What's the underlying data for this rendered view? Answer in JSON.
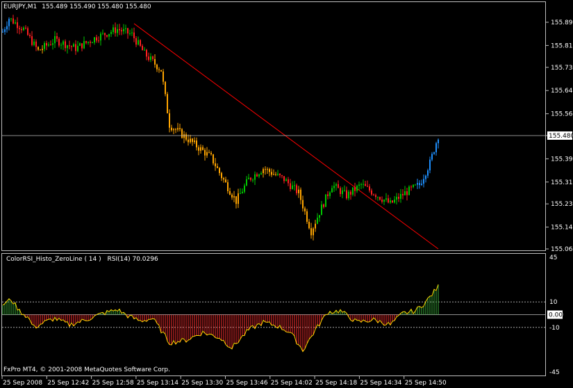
{
  "window": {
    "symbol_label": "EURJPY,M1",
    "ohlc_label": "155.489 155.490 155.480 155.480"
  },
  "price_axis": {
    "ticks": [
      "155.895",
      "155.810",
      "155.730",
      "155.645",
      "155.560",
      "155.480",
      "155.395",
      "155.310",
      "155.230",
      "155.145",
      "155.065"
    ],
    "current_price": "155.480"
  },
  "indicator": {
    "name": "ColorRSI_Histo_ZeroLine ( 14 )",
    "value_label": "RSI(14) 70.0296",
    "ticks": [
      "45",
      "10",
      "0.00",
      "-10",
      "-45"
    ],
    "current_marker": "0.00",
    "levels": [
      10,
      0,
      -10
    ]
  },
  "time_axis": {
    "labels": [
      "25 Sep 2008",
      "25 Sep 12:42",
      "25 Sep 12:58",
      "25 Sep 13:14",
      "25 Sep 13:30",
      "25 Sep 13:46",
      "25 Sep 14:02",
      "25 Sep 14:18",
      "25 Sep 14:34",
      "25 Sep 14:50"
    ]
  },
  "copyright": "FxPro MT4, © 2001-2008 MetaQuotes Software Corp.",
  "colors": {
    "background": "#000000",
    "bull": "#00C800",
    "bear": "#FF2020",
    "trend_down": "#FFA500",
    "trend_up": "#1E90FF",
    "trendline": "#FF0000",
    "rsi_line": "#FFD700",
    "rsi_pos": "#3CB43C",
    "rsi_neg": "#FF3030"
  },
  "chart_data": {
    "type": "candlestick",
    "symbol": "EURJPY",
    "timeframe": "M1",
    "ylim": [
      155.065,
      155.935
    ],
    "price_waypoints": [
      [
        0,
        155.86
      ],
      [
        3,
        155.91
      ],
      [
        10,
        155.87
      ],
      [
        17,
        155.79
      ],
      [
        25,
        155.83
      ],
      [
        35,
        155.8
      ],
      [
        45,
        155.84
      ],
      [
        55,
        155.87
      ],
      [
        62,
        155.85
      ],
      [
        68,
        155.78
      ],
      [
        76,
        155.72
      ],
      [
        80,
        155.52
      ],
      [
        90,
        155.46
      ],
      [
        100,
        155.4
      ],
      [
        105,
        155.33
      ],
      [
        112,
        155.24
      ],
      [
        118,
        155.32
      ],
      [
        125,
        155.36
      ],
      [
        135,
        155.32
      ],
      [
        142,
        155.27
      ],
      [
        148,
        155.13
      ],
      [
        152,
        155.2
      ],
      [
        158,
        155.3
      ],
      [
        165,
        155.26
      ],
      [
        172,
        155.3
      ],
      [
        180,
        155.26
      ],
      [
        186,
        155.23
      ],
      [
        193,
        155.27
      ],
      [
        200,
        155.3
      ],
      [
        205,
        155.38
      ],
      [
        209,
        155.48
      ]
    ],
    "style_segments": [
      {
        "from": 0,
        "to": 3,
        "style": "up"
      },
      {
        "from": 4,
        "to": 16,
        "style": "mixed"
      },
      {
        "from": 17,
        "to": 19,
        "style": "down"
      },
      {
        "from": 20,
        "to": 52,
        "style": "mixed"
      },
      {
        "from": 53,
        "to": 56,
        "style": "mixed"
      },
      {
        "from": 57,
        "to": 72,
        "style": "mixed"
      },
      {
        "from": 73,
        "to": 113,
        "style": "down"
      },
      {
        "from": 114,
        "to": 124,
        "style": "mixed"
      },
      {
        "from": 125,
        "to": 131,
        "style": "down"
      },
      {
        "from": 132,
        "to": 141,
        "style": "mixed"
      },
      {
        "from": 142,
        "to": 150,
        "style": "down"
      },
      {
        "from": 151,
        "to": 198,
        "style": "mixed"
      },
      {
        "from": 199,
        "to": 209,
        "style": "up"
      }
    ],
    "trendline": {
      "from": [
        63,
        155.89
      ],
      "to": [
        209,
        155.065
      ]
    },
    "rsi": {
      "ylim": [
        -45,
        45
      ],
      "waypoints": [
        [
          0,
          8
        ],
        [
          4,
          12
        ],
        [
          8,
          3
        ],
        [
          12,
          -2
        ],
        [
          15,
          -10
        ],
        [
          20,
          -6
        ],
        [
          25,
          -3
        ],
        [
          32,
          -8
        ],
        [
          40,
          -4
        ],
        [
          48,
          1
        ],
        [
          55,
          4
        ],
        [
          60,
          -1
        ],
        [
          66,
          -5
        ],
        [
          72,
          -3
        ],
        [
          80,
          -22
        ],
        [
          88,
          -20
        ],
        [
          96,
          -14
        ],
        [
          104,
          -18
        ],
        [
          110,
          -26
        ],
        [
          118,
          -12
        ],
        [
          125,
          -6
        ],
        [
          132,
          -9
        ],
        [
          138,
          -14
        ],
        [
          144,
          -28
        ],
        [
          150,
          -12
        ],
        [
          156,
          2
        ],
        [
          162,
          3
        ],
        [
          170,
          -6
        ],
        [
          178,
          -4
        ],
        [
          186,
          -8
        ],
        [
          192,
          1
        ],
        [
          198,
          3
        ],
        [
          203,
          10
        ],
        [
          209,
          22
        ]
      ]
    }
  }
}
